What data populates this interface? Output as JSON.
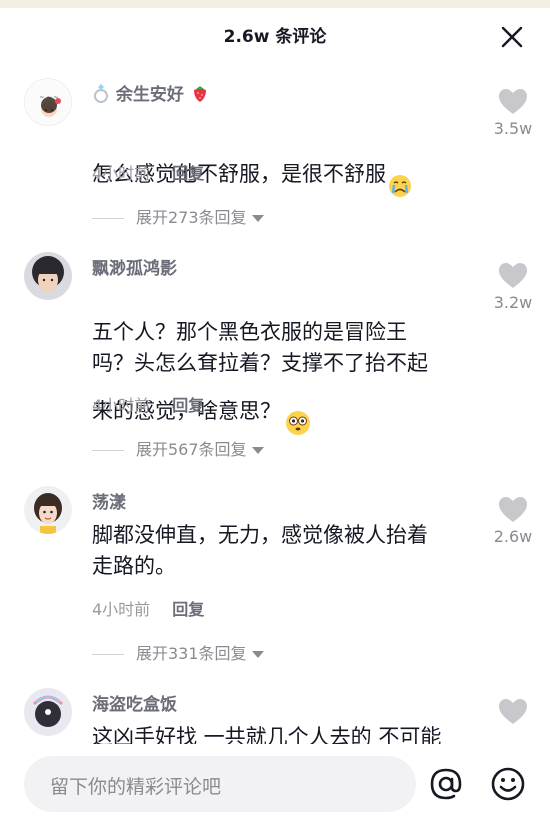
{
  "header": {
    "title": "2.6w 条评论"
  },
  "comments": [
    {
      "username": "余生安好",
      "text": "怎么感觉他不舒服，是很不舒服",
      "time": "4小时前",
      "reply_label": "回复",
      "expand_label": "展开273条回复",
      "likes": "3.5w"
    },
    {
      "username": "飘渺孤鸿影",
      "text": "五个人？那个黑色衣服的是冒险王\n吗？头怎么耷拉着？支撑不了抬不起\n来的感觉，啥意思？",
      "time": "4小时前",
      "reply_label": "回复",
      "expand_label": "展开567条回复",
      "likes": "3.2w"
    },
    {
      "username": "荡漾",
      "text": "脚都没伸直，无力，感觉像被人抬着\n走路的。",
      "time": "4小时前",
      "reply_label": "回复",
      "expand_label": "展开331条回复",
      "likes": "2.6w"
    },
    {
      "username": "海盗吃盒饭",
      "text": "这凶手好找 一共就几个人去的 不可能",
      "likes": ""
    }
  ],
  "input": {
    "placeholder": "留下你的精彩评论吧"
  },
  "colors": {
    "accent_text": "#161823",
    "muted": "#8a8b91",
    "input_bg": "#f2f2f4"
  }
}
